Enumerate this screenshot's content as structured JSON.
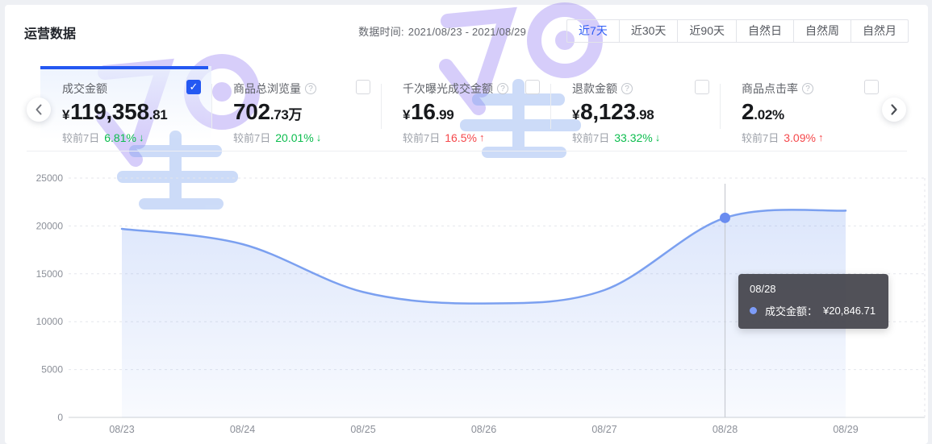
{
  "header": {
    "title": "运营数据",
    "date_prefix": "数据时间:",
    "date_range": "2021/08/23 - 2021/08/29",
    "tabs": [
      {
        "label": "近7天",
        "active": true
      },
      {
        "label": "近30天",
        "active": false
      },
      {
        "label": "近90天",
        "active": false
      },
      {
        "label": "自然日",
        "active": false
      },
      {
        "label": "自然周",
        "active": false
      },
      {
        "label": "自然月",
        "active": false
      }
    ]
  },
  "metrics": [
    {
      "id": "gmv",
      "label": "成交金额",
      "has_info": false,
      "checked": true,
      "selected": true,
      "value_prefix": "¥",
      "value_main": "119,358",
      "value_suffix": ".81",
      "delta_label": "较前7日",
      "delta_value": "6.81%",
      "delta_arrow": "↓",
      "delta_color": "green"
    },
    {
      "id": "views",
      "label": "商品总浏览量",
      "has_info": true,
      "checked": false,
      "selected": false,
      "value_prefix": "",
      "value_main": "702",
      "value_suffix": ".73万",
      "delta_label": "较前7日",
      "delta_value": "20.01%",
      "delta_arrow": "↓",
      "delta_color": "green"
    },
    {
      "id": "gmv-per-mille",
      "label": "千次曝光成交金额",
      "has_info": true,
      "checked": false,
      "selected": false,
      "value_prefix": "¥",
      "value_main": "16",
      "value_suffix": ".99",
      "delta_label": "较前7日",
      "delta_value": "16.5%",
      "delta_arrow": "↑",
      "delta_color": "red"
    },
    {
      "id": "refund",
      "label": "退款金额",
      "has_info": true,
      "checked": false,
      "selected": false,
      "value_prefix": "¥",
      "value_main": "8,123",
      "value_suffix": ".98",
      "delta_label": "较前7日",
      "delta_value": "33.32%",
      "delta_arrow": "↓",
      "delta_color": "green"
    },
    {
      "id": "ctr",
      "label": "商品点击率",
      "has_info": true,
      "checked": false,
      "selected": false,
      "value_prefix": "",
      "value_main": "2",
      "value_suffix": ".02%",
      "delta_label": "较前7日",
      "delta_value": "3.09%",
      "delta_arrow": "↑",
      "delta_color": "red"
    }
  ],
  "chart_data": {
    "type": "area",
    "title": "",
    "xlabel": "",
    "ylabel": "",
    "categories": [
      "08/23",
      "08/24",
      "08/25",
      "08/26",
      "08/27",
      "08/28",
      "08/29"
    ],
    "series": [
      {
        "name": "成交金额",
        "values": [
          19700,
          18100,
          13100,
          11900,
          13300,
          20846.71,
          21600
        ]
      }
    ],
    "ylim": [
      0,
      25000
    ],
    "yticks": [
      0,
      5000,
      10000,
      15000,
      20000,
      25000
    ],
    "grid": "horizontal-dashed",
    "legend_position": "none",
    "hover_index": 5
  },
  "tooltip": {
    "date": "08/28",
    "series_label": "成交金额",
    "separator": "：",
    "value": "¥20,846.71"
  },
  "icons": {
    "prev": "chevron-left",
    "next": "chevron-right",
    "info": "question-circle",
    "check": "✓"
  },
  "colors": {
    "accent_blue": "#2458f2",
    "tab_active_blue": "#2e5bf5",
    "line_blue": "#7ba0f0",
    "marker_blue": "#6a8cf0",
    "tooltip_dot_blue": "#7d9cf8",
    "green": "#0cbd4e",
    "red": "#f5484b",
    "grid_gray": "#e4e6eb",
    "axis_gray": "#ccd0d6",
    "hover_line_gray": "#c8cbd2",
    "tooltip_bg": "rgba(66,66,74,0.92)"
  }
}
